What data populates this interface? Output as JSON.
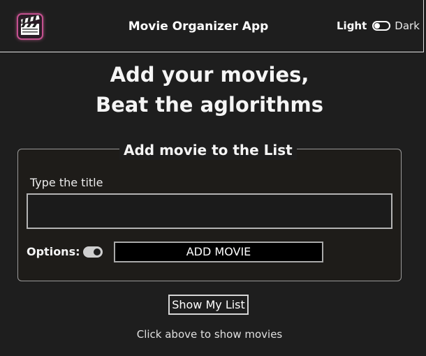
{
  "header": {
    "title": "Movie Organizer App",
    "logo_icon": "clapperboard-icon",
    "theme": {
      "light_label": "Light",
      "dark_label": "Dark",
      "current": "dark"
    }
  },
  "hero": {
    "line1": "Add your movies,",
    "line2": "Beat the aglorithms"
  },
  "add_form": {
    "legend": "Add movie to the List",
    "title_label": "Type the title",
    "title_value": "",
    "title_placeholder": "",
    "options_label": "Options:",
    "options_enabled": true,
    "add_button_label": "ADD MOVIE"
  },
  "list": {
    "show_button_label": "Show My List",
    "hint": "Click above to show movies"
  },
  "colors": {
    "background": "#1e1e1e",
    "text": "#f2f2f2",
    "logo_accent": "#c4508f"
  }
}
